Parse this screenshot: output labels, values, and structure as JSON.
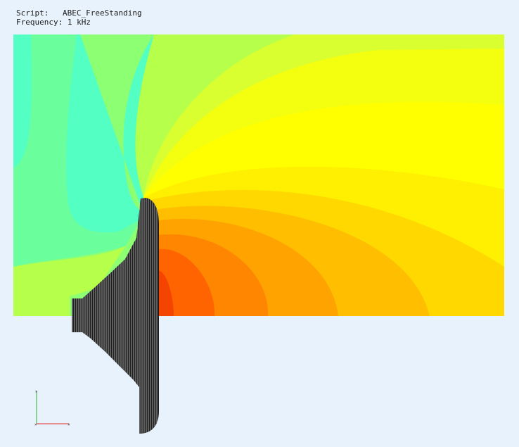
{
  "header": {
    "script_label": "Script:",
    "script_value": "ABEC_FreeStanding",
    "frequency_label": "Frequency:",
    "frequency_value": "1 kHz"
  },
  "field": {
    "contour_colors": [
      "#53ffc2",
      "#6aff9c",
      "#8dff73",
      "#b6ff4a",
      "#d9ff30",
      "#f4ff10",
      "#ffff00",
      "#ffef00",
      "#ffd800",
      "#ffbf00",
      "#ffa300",
      "#ff8600",
      "#ff6400",
      "#f44400"
    ]
  },
  "horn": {
    "mesh_color": "#1e1e1e",
    "mesh_line_color": "#bdbdbd"
  },
  "axes": {
    "x_color": "#e03030",
    "y_color": "#30b030"
  }
}
